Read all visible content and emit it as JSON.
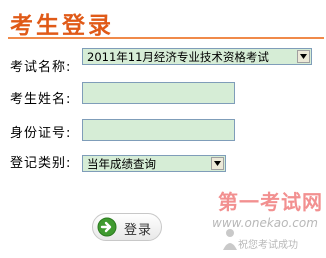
{
  "page": {
    "title": "考生登录"
  },
  "form": {
    "exam_name_label": "考试名称:",
    "exam_name_value": "2011年11月经济专业技术资格考试",
    "name_label": "考生姓名:",
    "name_value": "",
    "id_label": "身份证号:",
    "id_value": "",
    "category_label": "登记类别:",
    "category_value": "当年成绩查询",
    "login_label": "登录"
  },
  "watermark": {
    "title": "第一考试网",
    "url": "www.onekao.com",
    "slogan": "祝您考试成功"
  },
  "colors": {
    "title": "#e05a18",
    "field_bg": "#d6edd6",
    "watermark": "#ee6b6b"
  }
}
